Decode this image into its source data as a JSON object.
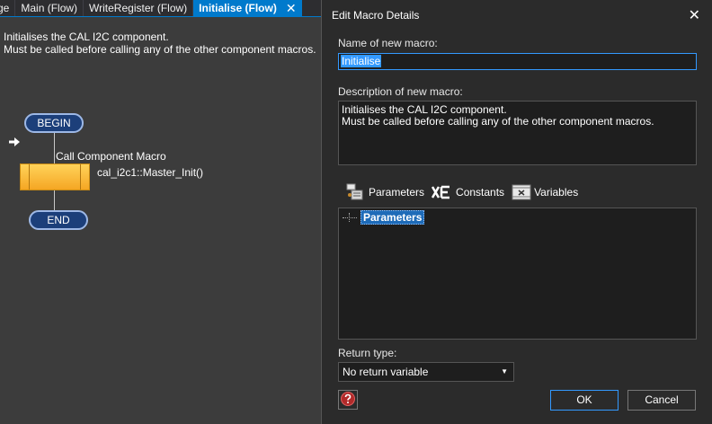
{
  "tabs": [
    {
      "label": "ge"
    },
    {
      "label": "Main (Flow)"
    },
    {
      "label": "WriteRegister (Flow)"
    },
    {
      "label": "Initialise (Flow)",
      "close": "✕",
      "active": true
    }
  ],
  "flowchart": {
    "description_lines": [
      "Initialises the CAL I2C component.",
      "Must be called before calling any of the other component macros."
    ],
    "begin_label": "BEGIN",
    "end_label": "END",
    "macro_block_title": "Call Component Macro",
    "macro_call": "cal_i2c1::Master_Init()",
    "block_color": "#f5a623"
  },
  "dialog": {
    "title": "Edit Macro Details",
    "close": "✕",
    "name_label": "Name of new macro:",
    "name_value": "Initialise",
    "description_label": "Description of new macro:",
    "description_lines": [
      "Initialises the CAL I2C component.",
      "Must be called before calling any of the other component macros."
    ],
    "toolbar": {
      "parameters_label": "Parameters",
      "constants_label": "Constants",
      "variables_label": "Variables"
    },
    "tree": {
      "root_label": "Parameters"
    },
    "return_type_label": "Return type:",
    "return_type_value": "No return variable",
    "ok_label": "OK",
    "cancel_label": "Cancel",
    "accent_color": "#3399ff"
  },
  "icons": {
    "parameters": "parameters-icon",
    "constants": "constants-icon",
    "variables": "variables-icon",
    "help": "help-icon",
    "run_marker": "arrow-right-icon"
  }
}
